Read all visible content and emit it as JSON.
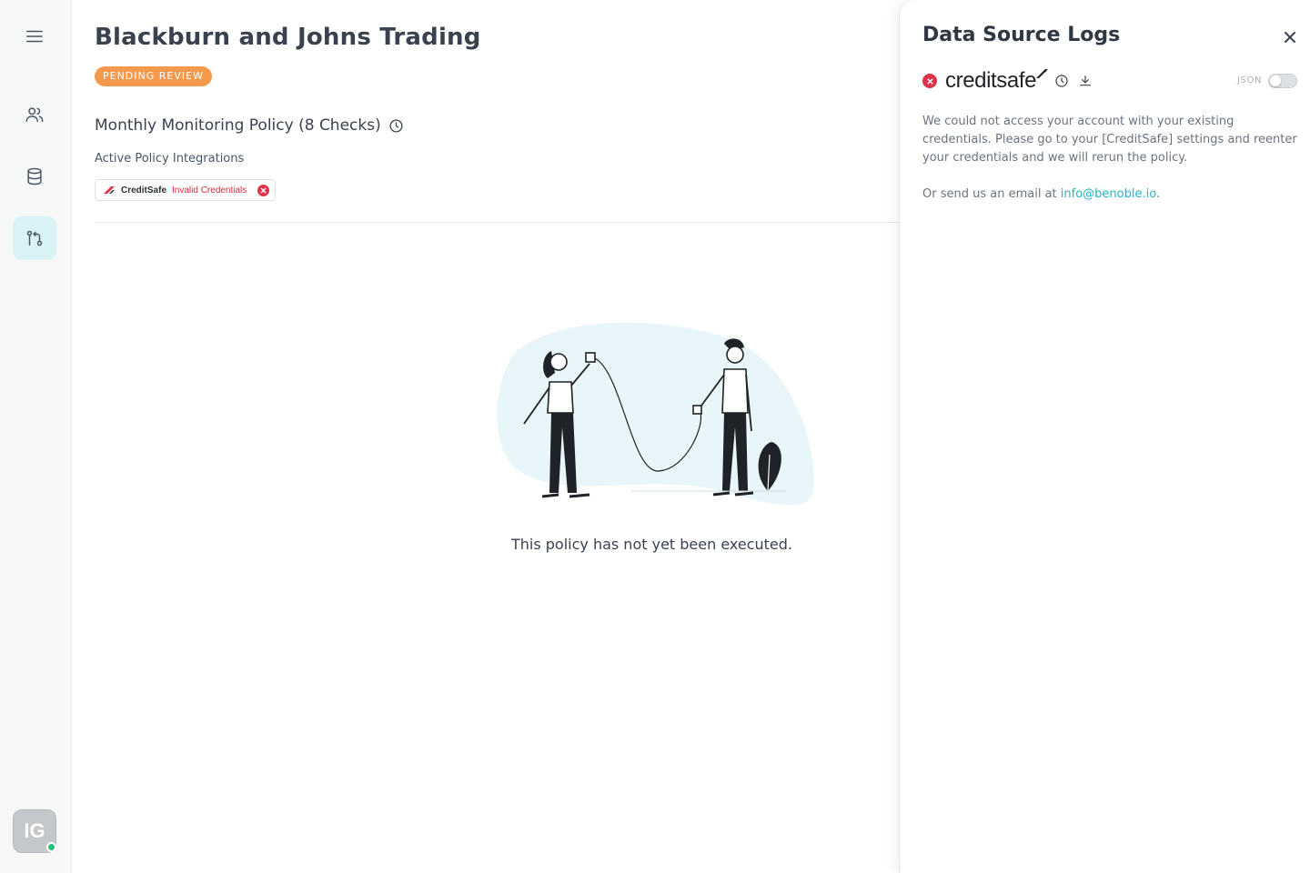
{
  "sidebar": {
    "items": [
      {
        "name": "menu",
        "icon": "hamburger-menu-icon"
      },
      {
        "name": "users",
        "icon": "users-icon"
      },
      {
        "name": "data-sources",
        "icon": "database-icon"
      },
      {
        "name": "policies",
        "icon": "git-branch-icon",
        "active": true
      }
    ],
    "avatar_initials": "IG",
    "active_color": "#d9f3f6",
    "presence_color": "#24c27a"
  },
  "main": {
    "title": "Blackburn and Johns Trading",
    "status_badge": "PENDING REVIEW",
    "status_color": "#f59a4c",
    "policy_title": "Monthly Monitoring Policy (8 Checks)",
    "integrations_label": "Active Policy Integrations",
    "integration": {
      "name": "CreditSafe",
      "status": "Invalid Credentials",
      "status_color": "#d32f3f"
    },
    "empty_message": "This policy has not yet been executed."
  },
  "panel": {
    "title": "Data Source Logs",
    "source_logo_text": "creditsafe",
    "json_toggle_label": "JSON",
    "json_toggle_on": false,
    "message_line": "We could not access your account with your existing credentials. Please go to your [CreditSafe] settings and reenter your credentials and we will rerun the policy.",
    "email_prefix": "Or send us an email at ",
    "email": "info@benoble.io",
    "email_suffix": ".",
    "link_color": "#1fb5c9",
    "error_color": "#e0324a"
  }
}
